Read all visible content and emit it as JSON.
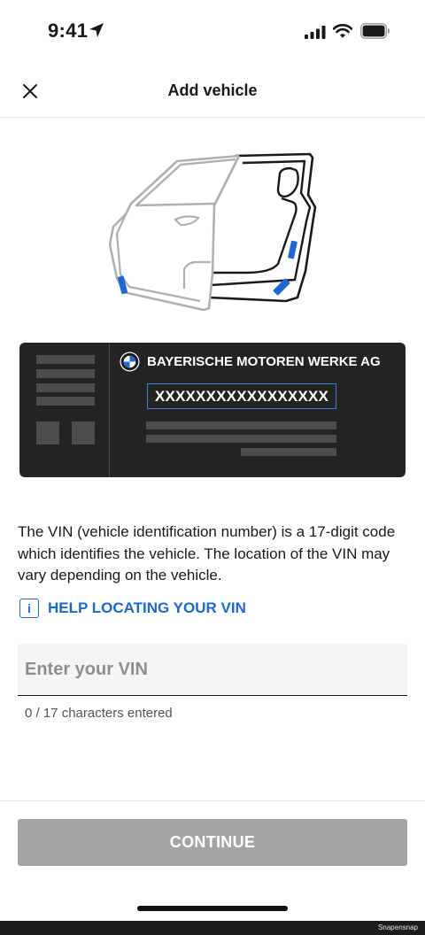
{
  "status_bar": {
    "time": "9:41",
    "icons": [
      "location-arrow-icon",
      "cellular-signal-icon",
      "wifi-icon",
      "battery-icon"
    ]
  },
  "header": {
    "title": "Add vehicle",
    "close_icon": "close-icon"
  },
  "vin_plate": {
    "manufacturer": "BAYERISCHE MOTOREN WERKE AG",
    "vin_placeholder": "XXXXXXXXXXXXXXXXX",
    "logo": "bmw-logo",
    "background_color": "#232323",
    "highlight_color": "#3b82e0"
  },
  "description": "The VIN (vehicle identification number) is a 17-digit code which identifies the vehicle. The location of the VIN may vary depending on the vehicle.",
  "help_link": {
    "icon": "info-icon",
    "label": "HELP LOCATING YOUR VIN"
  },
  "vin_input": {
    "placeholder": "Enter your VIN",
    "value": "",
    "counter": "0 / 17 characters entered"
  },
  "continue_button": {
    "label": "CONTINUE",
    "color": "#a4a4a4",
    "enabled": false
  },
  "watermark": "Snapensnap",
  "colors": {
    "accent": "#1c69d4",
    "marker_blue": "#1c69d4"
  }
}
